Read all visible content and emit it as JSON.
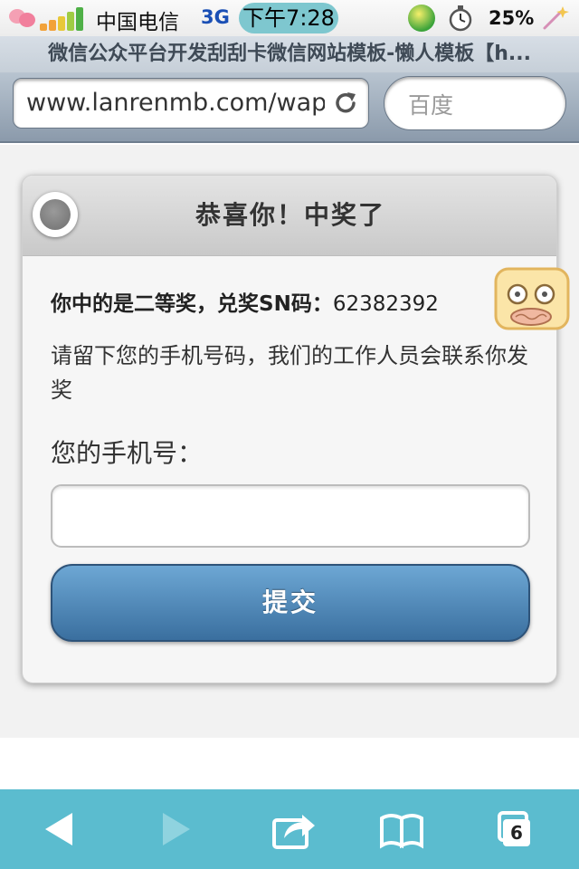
{
  "status_bar": {
    "carrier": "中国电信",
    "network": "3G",
    "time": "下午7:28",
    "battery": "25%",
    "signal_bars": 5
  },
  "browser": {
    "page_title": "微信公众平台开发刮刮卡微信网站模板-懒人模板【h...",
    "url": "www.lanrenmb.com/wap",
    "search_placeholder": "百度",
    "tab_count": "6"
  },
  "dialog": {
    "title": "恭喜你！中奖了",
    "prize_prefix": "你中的是二等奖，兑奖SN码：",
    "sn_code": "62382392",
    "hint": "请留下您的手机号码，我们的工作人员会联系你发奖",
    "phone_label": "您的手机号：",
    "phone_value": "",
    "submit_label": "提交"
  },
  "colors": {
    "toolbar": "#5bbccf",
    "submit_button": "#4f88b8",
    "url_bar": "#9aa8b8"
  },
  "icons": {
    "back": "arrow-left-icon",
    "forward": "arrow-right-icon",
    "share": "share-icon",
    "bookmarks": "book-icon",
    "tabs": "tabs-icon"
  }
}
